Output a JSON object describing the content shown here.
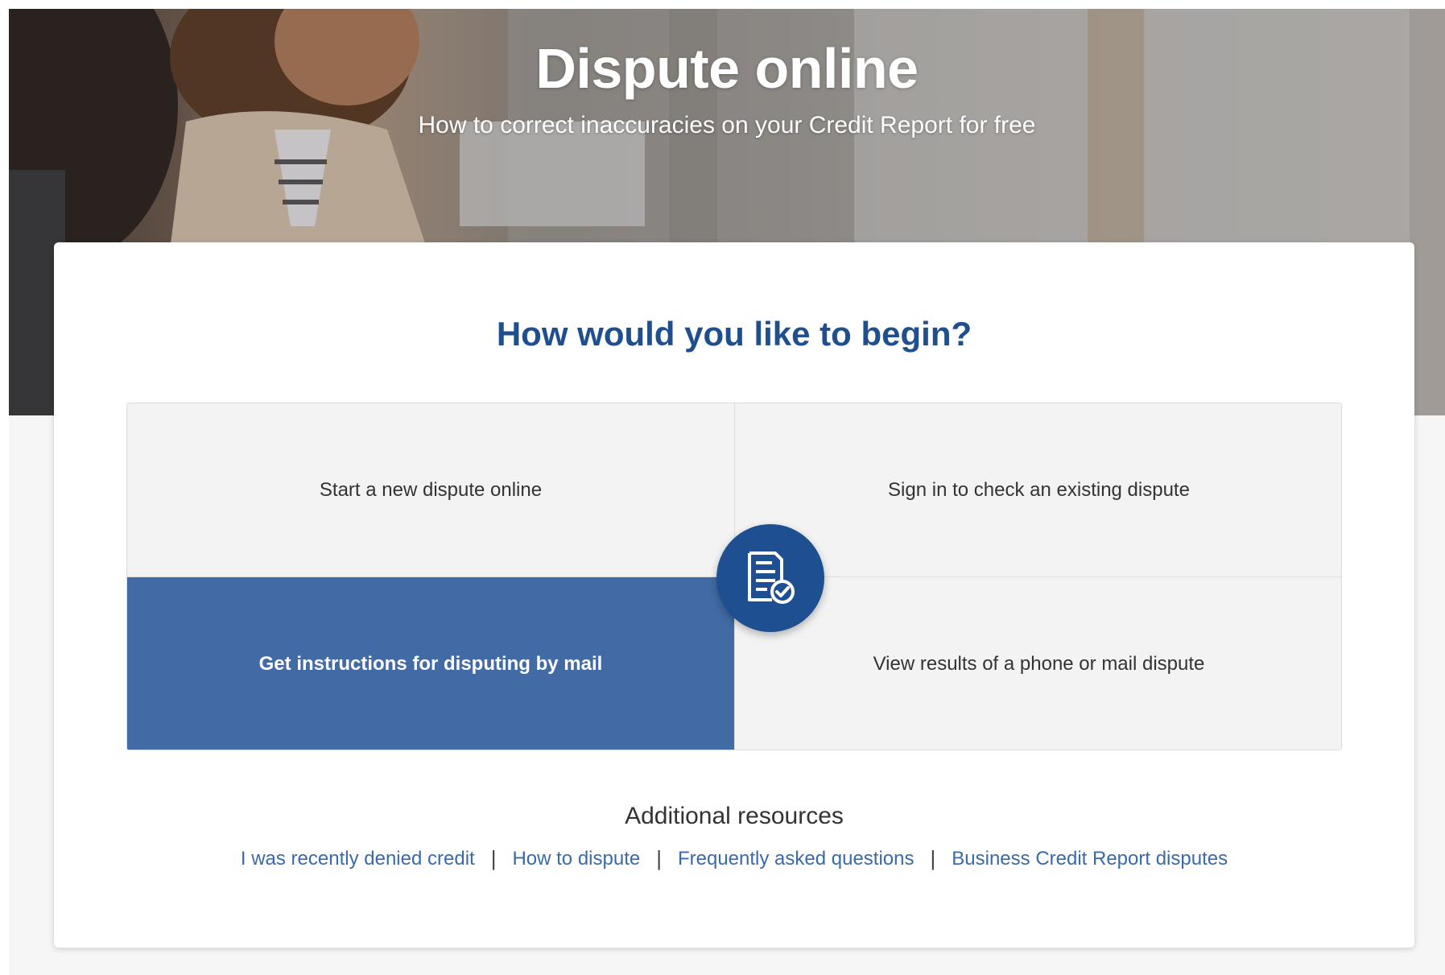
{
  "hero": {
    "title": "Dispute online",
    "subtitle": "How to correct inaccuracies on your Credit Report for free"
  },
  "card": {
    "heading": "How would you like to begin?",
    "options": [
      {
        "label": "Start a new dispute online",
        "selected": false
      },
      {
        "label": "Sign in to check an existing dispute",
        "selected": false
      },
      {
        "label": "Get instructions for disputing by mail",
        "selected": true
      },
      {
        "label": "View results of a phone or mail dispute",
        "selected": false
      }
    ],
    "badge_icon": "document-check-icon"
  },
  "resources": {
    "heading": "Additional resources",
    "links": [
      "I was recently denied credit",
      "How to dispute",
      "Frequently asked questions",
      "Business Credit Report disputes"
    ],
    "separator": "|"
  },
  "colors": {
    "brand_blue": "#1d4f91",
    "selected_option": "#426aa5",
    "heading_blue": "#1f4f8c",
    "link_blue": "#3a6aa8"
  }
}
